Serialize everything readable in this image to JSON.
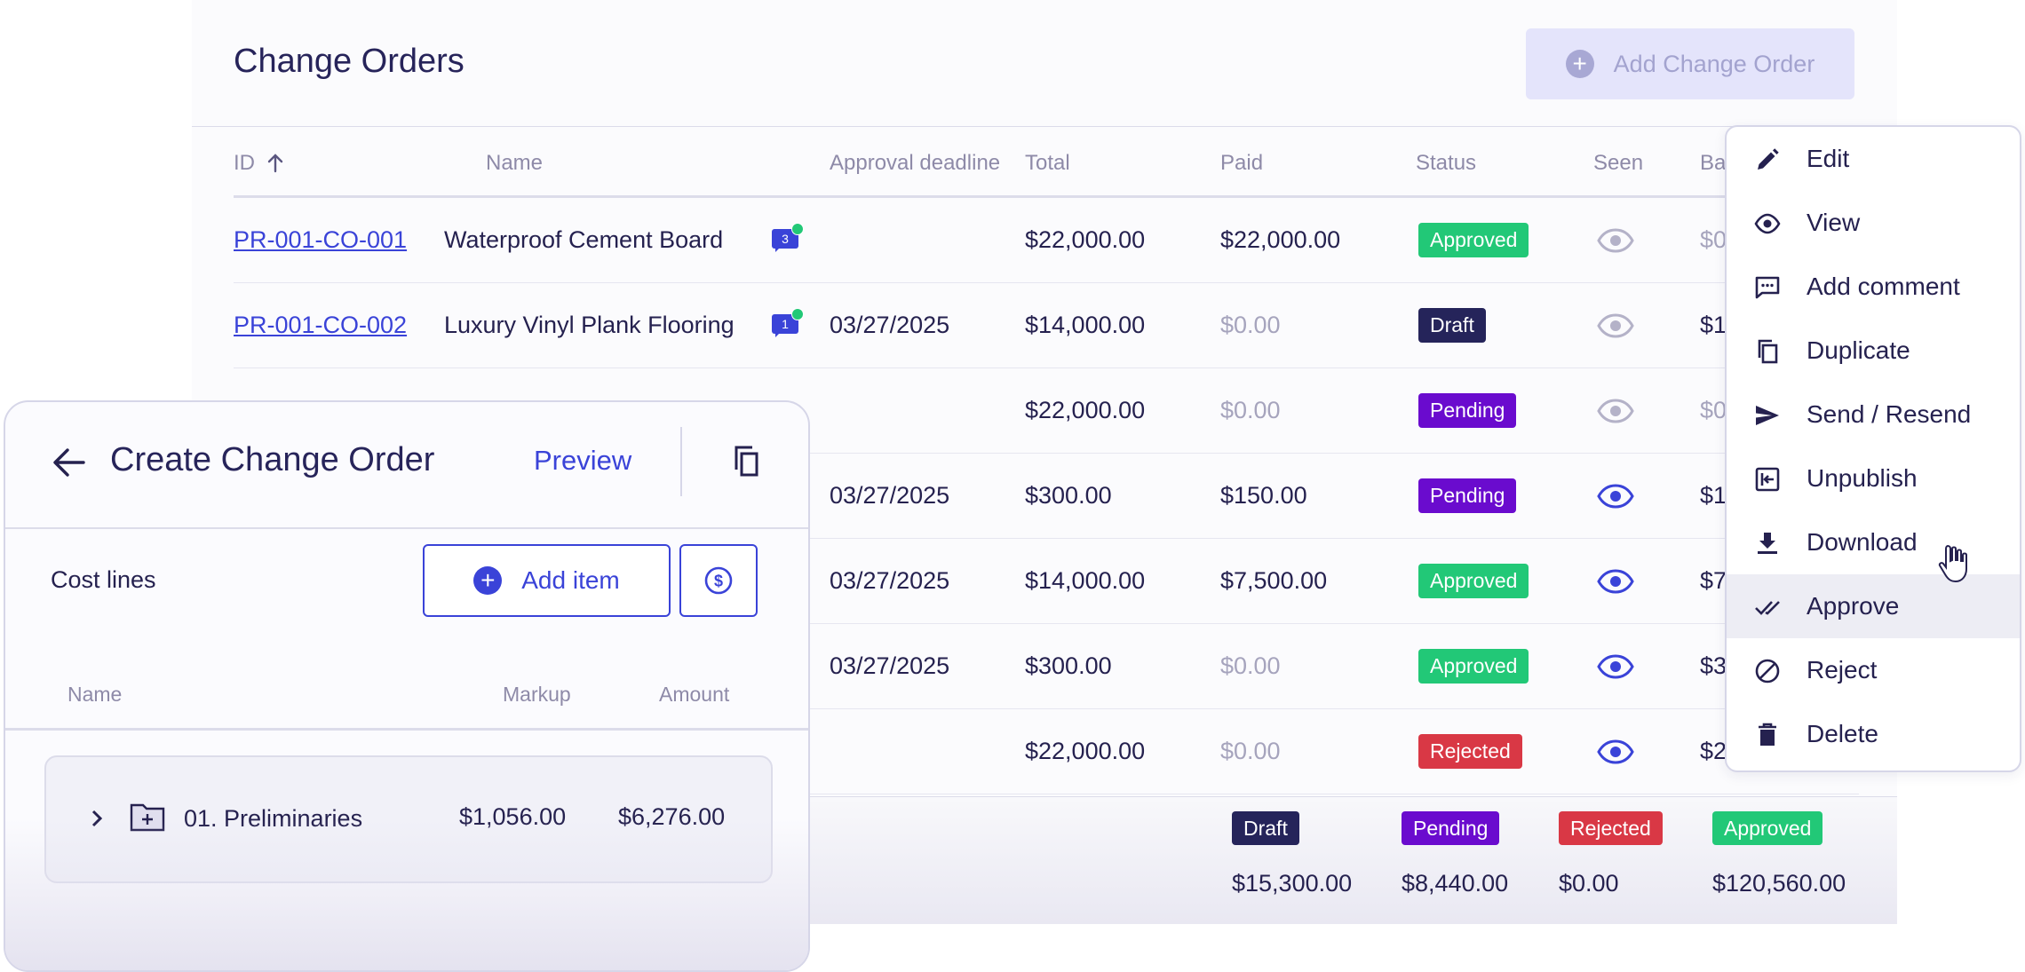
{
  "page": {
    "title": "Change Orders",
    "add_button": "Add Change Order"
  },
  "table": {
    "headers": {
      "id": "ID",
      "name": "Name",
      "deadline": "Approval deadline",
      "total": "Total",
      "paid": "Paid",
      "status": "Status",
      "seen": "Seen",
      "balance": "Ba"
    },
    "sort_indicator": "ascending",
    "rows": [
      {
        "id": "PR-001-CO-001",
        "name": "Waterproof Cement Board",
        "comments": "3",
        "deadline": "",
        "total": "$22,000.00",
        "paid": "$22,000.00",
        "status": "Approved",
        "seen": false,
        "balance": "$0"
      },
      {
        "id": "PR-001-CO-002",
        "name": "Luxury Vinyl Plank Flooring",
        "comments": "1",
        "deadline": "03/27/2025",
        "total": "$14,000.00",
        "paid": "$0.00",
        "status": "Draft",
        "seen": false,
        "balance": "$1"
      },
      {
        "id": "",
        "name": "",
        "comments": "",
        "deadline": "",
        "total": "$22,000.00",
        "paid": "$0.00",
        "status": "Pending",
        "seen": false,
        "balance": "$0"
      },
      {
        "id": "",
        "name": "",
        "comments": "",
        "deadline": "03/27/2025",
        "total": "$300.00",
        "paid": "$150.00",
        "status": "Pending",
        "seen": true,
        "balance": "$1"
      },
      {
        "id": "",
        "name": "",
        "comments": "",
        "deadline": "03/27/2025",
        "total": "$14,000.00",
        "paid": "$7,500.00",
        "status": "Approved",
        "seen": true,
        "balance": "$7"
      },
      {
        "id": "",
        "name": "",
        "comments": "",
        "deadline": "03/27/2025",
        "total": "$300.00",
        "paid": "$0.00",
        "status": "Approved",
        "seen": true,
        "balance": "$3"
      },
      {
        "id": "",
        "name": "",
        "comments": "",
        "deadline": "",
        "total": "$22,000.00",
        "paid": "$0.00",
        "status": "Rejected",
        "seen": true,
        "balance": "$2"
      }
    ]
  },
  "summary": [
    {
      "label": "Draft",
      "value": "$15,300.00"
    },
    {
      "label": "Pending",
      "value": "$8,440.00"
    },
    {
      "label": "Rejected",
      "value": "$0.00"
    },
    {
      "label": "Approved",
      "value": "$120,560.00"
    }
  ],
  "menu": {
    "items": [
      {
        "label": "Edit",
        "icon": "pencil-icon"
      },
      {
        "label": "View",
        "icon": "eye-icon"
      },
      {
        "label": "Add comment",
        "icon": "comment-icon"
      },
      {
        "label": "Duplicate",
        "icon": "copy-icon"
      },
      {
        "label": "Send / Resend",
        "icon": "send-icon"
      },
      {
        "label": "Unpublish",
        "icon": "unpublish-icon"
      },
      {
        "label": "Download",
        "icon": "download-icon"
      },
      {
        "label": "Approve",
        "icon": "double-check-icon"
      },
      {
        "label": "Reject",
        "icon": "block-icon"
      },
      {
        "label": "Delete",
        "icon": "trash-icon"
      }
    ],
    "highlighted": "Approve"
  },
  "panel": {
    "title": "Create Change Order",
    "preview": "Preview",
    "cost_lines_label": "Cost lines",
    "add_item": "Add item",
    "columns": {
      "name": "Name",
      "markup": "Markup",
      "amount": "Amount"
    },
    "group": {
      "name": "01. Preliminaries",
      "markup": "$1,056.00",
      "amount": "$6,276.00"
    }
  },
  "colors": {
    "accent": "#3a43d8",
    "approved": "#22c877",
    "draft": "#25245a",
    "pending": "#6a0bce",
    "rejected": "#d93845",
    "text": "#25214f",
    "muted": "#a6a4bd"
  }
}
